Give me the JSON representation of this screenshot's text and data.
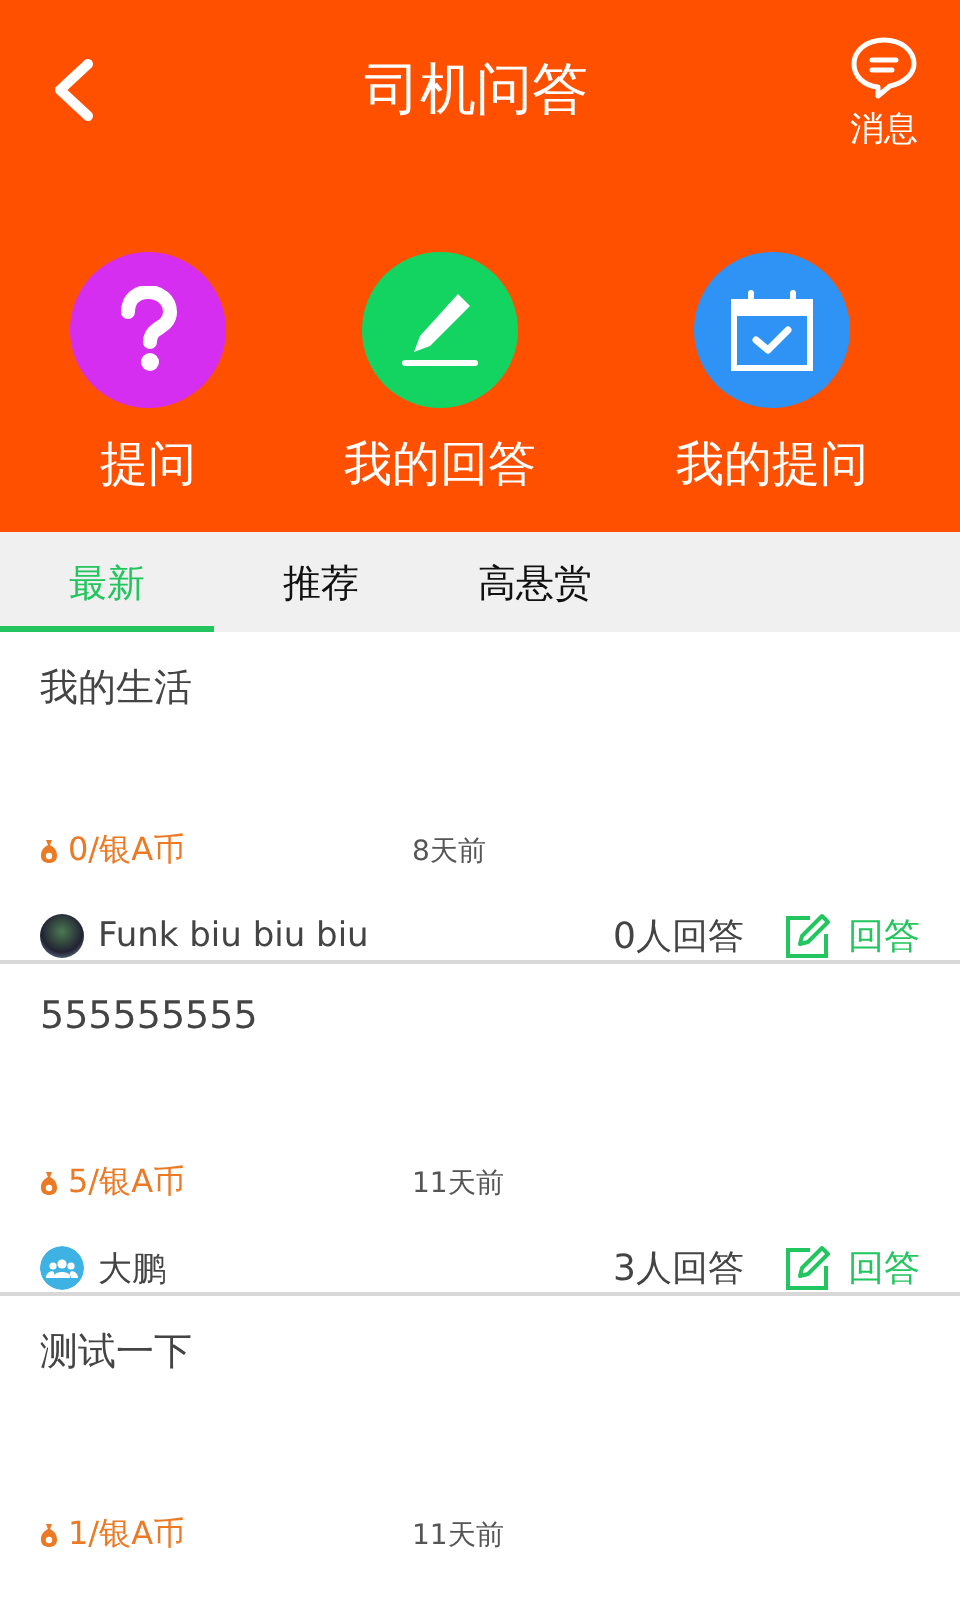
{
  "header": {
    "title": "司机问答",
    "messages_label": "消息"
  },
  "shortcuts": [
    {
      "kind": "ask",
      "label": "提问",
      "color": "#d62ef0"
    },
    {
      "kind": "answers",
      "label": "我的回答",
      "color": "#14d461"
    },
    {
      "kind": "questions",
      "label": "我的提问",
      "color": "#2e93f5"
    }
  ],
  "tabs": [
    {
      "label": "最新",
      "selected": true
    },
    {
      "label": "推荐",
      "selected": false
    },
    {
      "label": "高悬赏",
      "selected": false
    }
  ],
  "questions": [
    {
      "title": "我的生活",
      "reward": "0/银A币",
      "time": "8天前",
      "author": "Funk biu biu biu",
      "photo_avatar": true,
      "answer_count": "0人回答",
      "answer_label": "回答"
    },
    {
      "title": "555555555",
      "reward": "5/银A币",
      "time": "11天前",
      "author": "大鹏",
      "photo_avatar": false,
      "answer_count": "3人回答",
      "answer_label": "回答"
    },
    {
      "title": "测试一下",
      "reward": "1/银A币",
      "time": "11天前"
    }
  ]
}
